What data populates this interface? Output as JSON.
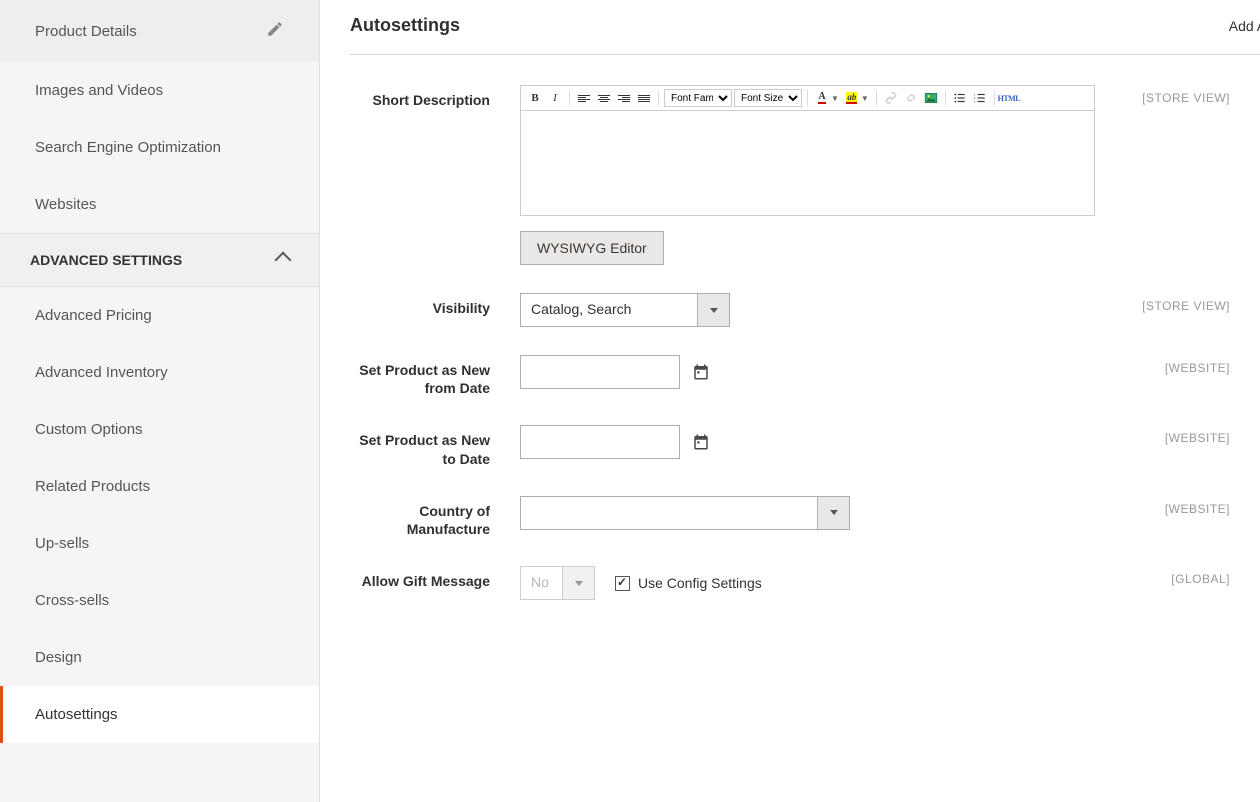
{
  "sidebar": {
    "basic_items": [
      {
        "label": "Product Details",
        "has_pencil": true
      },
      {
        "label": "Images and Videos"
      },
      {
        "label": "Search Engine Optimization"
      },
      {
        "label": "Websites"
      }
    ],
    "advanced_header": "ADVANCED SETTINGS",
    "advanced_items": [
      {
        "label": "Advanced Pricing"
      },
      {
        "label": "Advanced Inventory"
      },
      {
        "label": "Custom Options"
      },
      {
        "label": "Related Products"
      },
      {
        "label": "Up-sells"
      },
      {
        "label": "Cross-sells"
      },
      {
        "label": "Design"
      },
      {
        "label": "Autosettings",
        "active": true
      }
    ]
  },
  "header": {
    "title": "Autosettings",
    "add_attr": "Add At"
  },
  "fields": {
    "short_desc": {
      "label": "Short Description",
      "scope": "[STORE VIEW]",
      "wysiwyg_btn": "WYSIWYG Editor",
      "font_family": "Font Family",
      "font_size": "Font Size",
      "html_label": "HTML"
    },
    "visibility": {
      "label": "Visibility",
      "value": "Catalog, Search",
      "scope": "[STORE VIEW]"
    },
    "new_from": {
      "label": "Set Product as New from Date",
      "value": "",
      "scope": "[WEBSITE]"
    },
    "new_to": {
      "label": "Set Product as New to Date",
      "value": "",
      "scope": "[WEBSITE]"
    },
    "country": {
      "label": "Country of Manufacture",
      "value": "",
      "scope": "[WEBSITE]"
    },
    "gift": {
      "label": "Allow Gift Message",
      "value": "No",
      "use_config": "Use Config Settings",
      "scope": "[GLOBAL]"
    }
  }
}
